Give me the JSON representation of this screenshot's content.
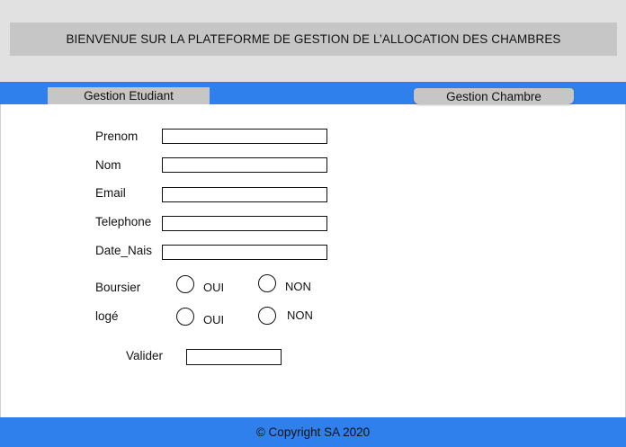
{
  "banner": {
    "title": "BIENVENUE SUR LA PLATEFORME DE GESTION  DE L’ALLOCATION DES CHAMBRES"
  },
  "nav": {
    "tab_etudiant": "Gestion Etudiant",
    "tab_chambre": "Gestion Chambre"
  },
  "form": {
    "prenom_label": "Prenom",
    "nom_label": "Nom",
    "email_label": "Email",
    "telephone_label": "Telephone",
    "date_nais_label": "Date_Nais",
    "prenom_value": "",
    "nom_value": "",
    "email_value": "",
    "telephone_value": "",
    "date_nais_value": "",
    "boursier_label": "Boursier",
    "boursier_oui": "OUI",
    "boursier_non": "NON",
    "loge_label": "logé",
    "loge_oui": "OUI",
    "loge_non": "NON",
    "valider_label": "Valider",
    "valider_value": ""
  },
  "footer": {
    "copyright": "© Copyright SA 2020"
  },
  "colors": {
    "accent": "#2f80ed",
    "banner_bg": "#c6c6c6",
    "header_bg": "#e1e1e1"
  }
}
